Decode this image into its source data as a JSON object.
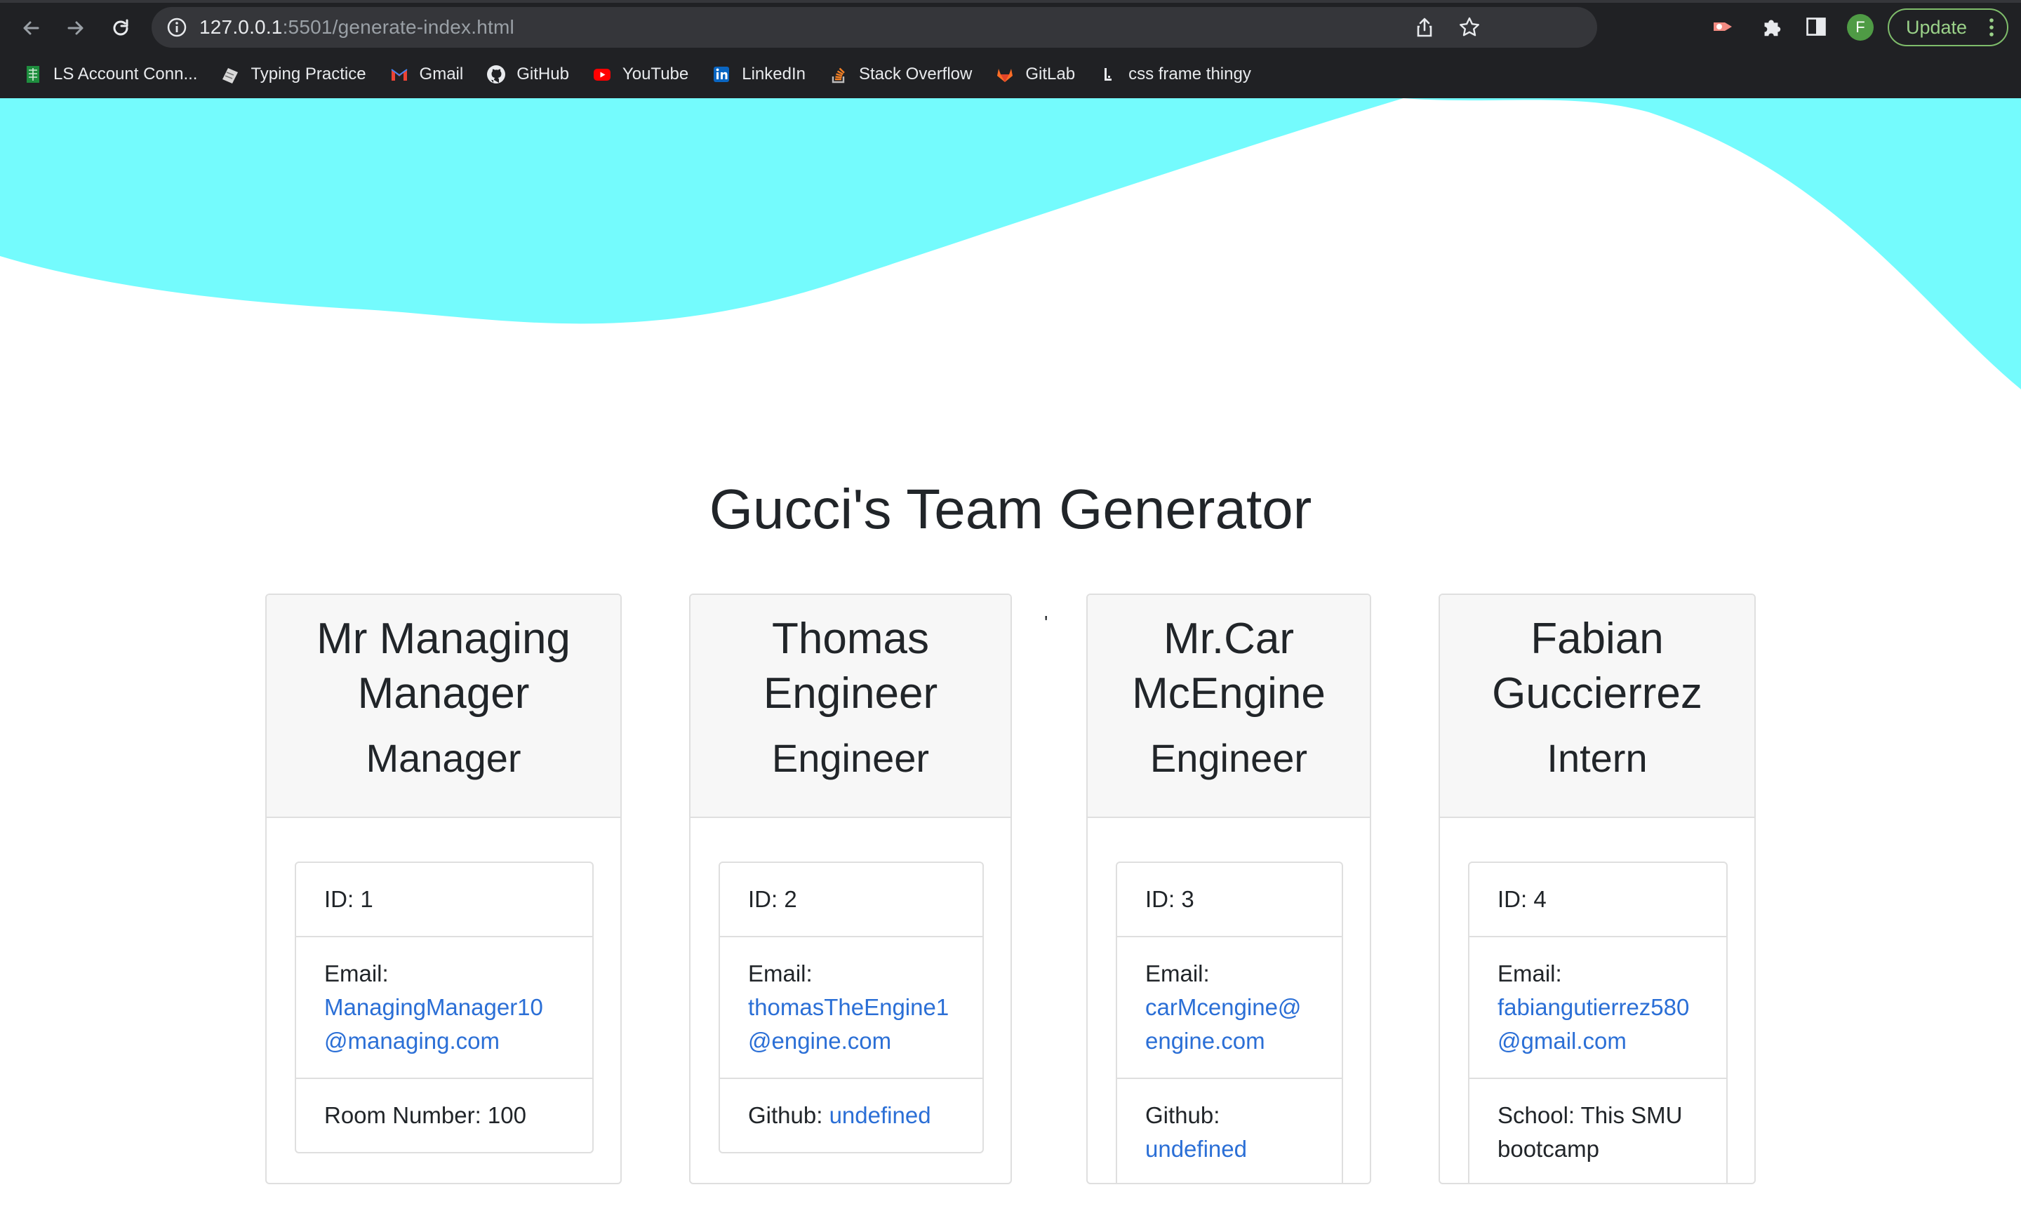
{
  "browser": {
    "url_host": "127.0.0.1",
    "url_path": ":5501/generate-index.html",
    "profile_initial": "F",
    "update_label": "Update",
    "bookmarks": [
      {
        "label": "LS Account Conn...",
        "icon": "spreadsheet-icon"
      },
      {
        "label": "Typing Practice",
        "icon": "keyboard-icon"
      },
      {
        "label": "Gmail",
        "icon": "gmail-icon"
      },
      {
        "label": "GitHub",
        "icon": "github-icon"
      },
      {
        "label": "YouTube",
        "icon": "youtube-icon"
      },
      {
        "label": "LinkedIn",
        "icon": "linkedin-icon"
      },
      {
        "label": "Stack Overflow",
        "icon": "stackoverflow-icon"
      },
      {
        "label": "GitLab",
        "icon": "gitlab-icon"
      },
      {
        "label": "css frame thingy",
        "icon": "bookmark-icon"
      }
    ]
  },
  "colors": {
    "wave": "#74fbfd",
    "link": "#2b6fd6",
    "card_header_bg": "#f7f7f7",
    "border": "#dfdfdf"
  },
  "page": {
    "title": "Gucci's Team Generator",
    "stray_mark": "'"
  },
  "team": [
    {
      "name": "Mr Managing Manager",
      "role": "Manager",
      "id_text": "ID: 1",
      "email_label": "Email:",
      "email": "ManagingManager10@managing.com",
      "extra_label": "Room Number: 100",
      "extra_value": ""
    },
    {
      "name": "Thomas Engineer",
      "role": "Engineer",
      "id_text": "ID: 2",
      "email_label": "Email:",
      "email": "thomasTheEngine1@engine.com",
      "extra_label": "Github:",
      "extra_value": "undefined"
    },
    {
      "name": "Mr.Car McEngine",
      "role": "Engineer",
      "id_text": "ID: 3",
      "email_label": "Email:",
      "email": "carMcengine@engine.com",
      "extra_label": "Github:",
      "extra_value": "undefined"
    },
    {
      "name": "Fabian Guccierrez",
      "role": "Intern",
      "id_text": "ID: 4",
      "email_label": "Email:",
      "email": "fabiangutierrez580@gmail.com",
      "extra_label": "School: This SMU bootcamp",
      "extra_value": ""
    }
  ]
}
